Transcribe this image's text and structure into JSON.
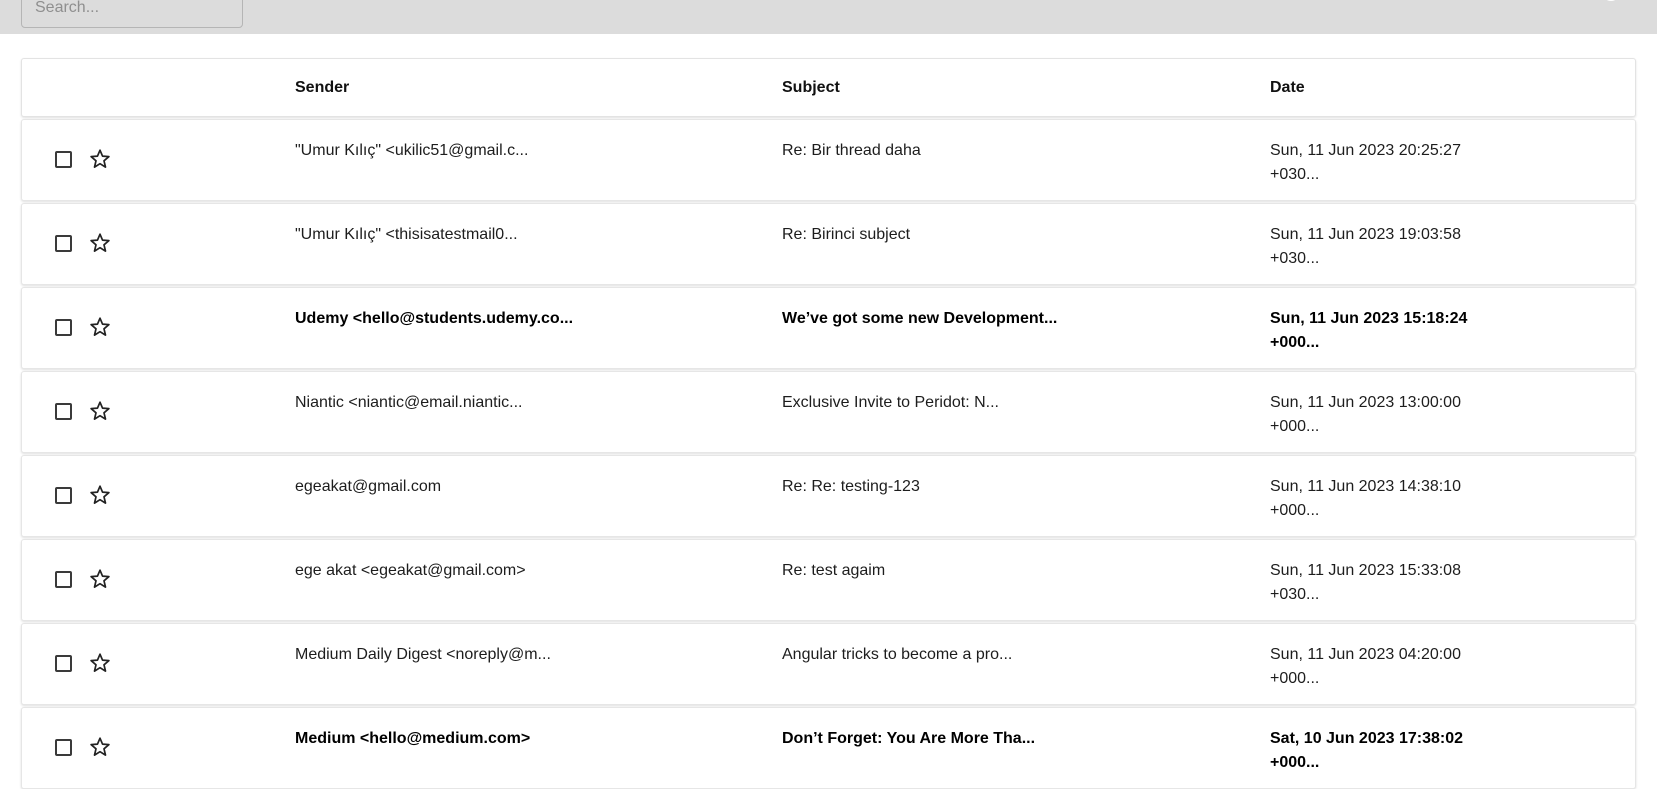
{
  "search": {
    "placeholder": "Search..."
  },
  "table": {
    "headers": {
      "sender": "Sender",
      "subject": "Subject",
      "date": "Date"
    },
    "rows": [
      {
        "sender": "\"Umur Kılıç\" <ukilic51@gmail.c...",
        "subject": "Re: Bir thread daha",
        "date_line1": "Sun, 11 Jun 2023 20:25:27",
        "date_line2": "+030...",
        "unread": false
      },
      {
        "sender": "\"Umur Kılıç\" <thisisatestmail0...",
        "subject": "Re: Birinci subject",
        "date_line1": "Sun, 11 Jun 2023 19:03:58",
        "date_line2": "+030...",
        "unread": false
      },
      {
        "sender": "Udemy <hello@students.udemy.co...",
        "subject": "We’ve got some new Development...",
        "date_line1": "Sun, 11 Jun 2023 15:18:24",
        "date_line2": "+000...",
        "unread": true
      },
      {
        "sender": "Niantic <niantic@email.niantic...",
        "subject": "Exclusive Invite to Peridot: N...",
        "date_line1": "Sun, 11 Jun 2023 13:00:00",
        "date_line2": "+000...",
        "unread": false
      },
      {
        "sender": "egeakat@gmail.com",
        "subject": "Re: Re: testing-123",
        "date_line1": "Sun, 11 Jun 2023 14:38:10",
        "date_line2": "+000...",
        "unread": false
      },
      {
        "sender": "ege akat <egeakat@gmail.com>",
        "subject": "Re: test agaim",
        "date_line1": "Sun, 11 Jun 2023 15:33:08",
        "date_line2": "+030...",
        "unread": false
      },
      {
        "sender": "Medium Daily Digest <noreply@m...",
        "subject": "Angular tricks to become a pro...",
        "date_line1": "Sun, 11 Jun 2023 04:20:00",
        "date_line2": "+000...",
        "unread": false
      },
      {
        "sender": "Medium <hello@medium.com>",
        "subject": "Don’t Forget: You Are More Tha...",
        "date_line1": "Sat, 10 Jun 2023 17:38:02",
        "date_line2": "+000...",
        "unread": true
      }
    ]
  },
  "icons": {
    "account": "account-circle-icon",
    "star": "star-outline-icon",
    "checkbox": "checkbox-unchecked-icon"
  }
}
